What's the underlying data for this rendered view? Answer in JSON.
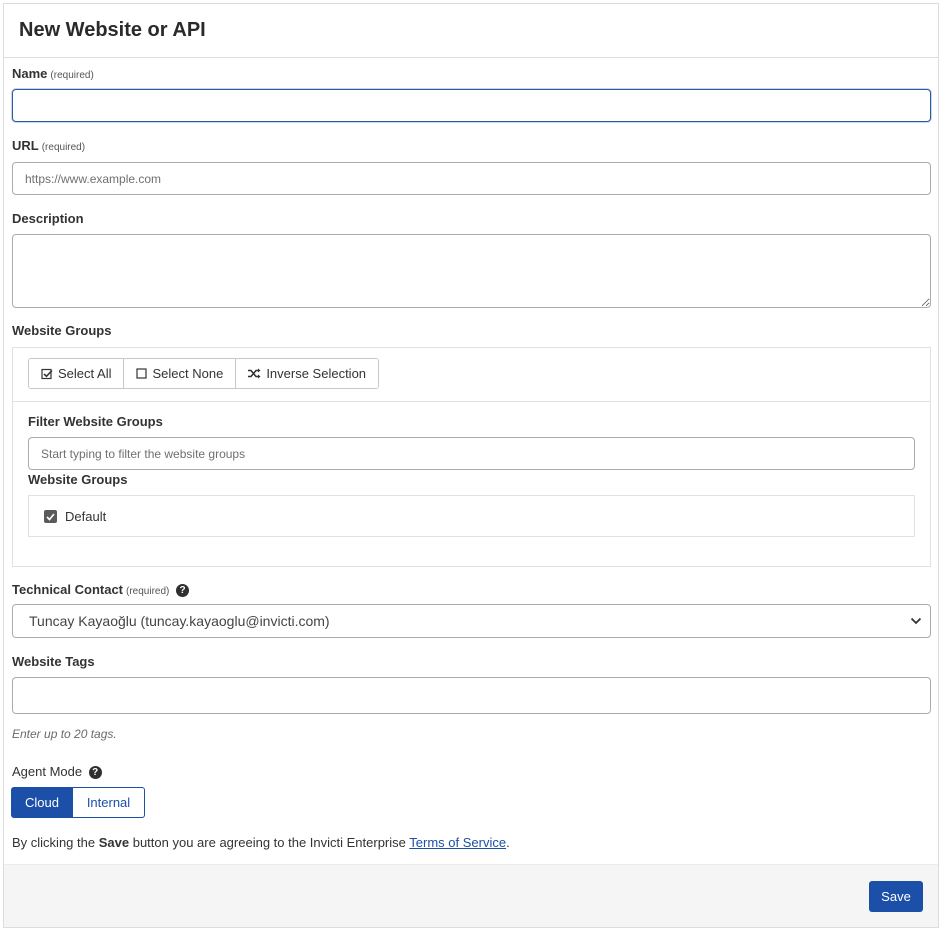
{
  "header": {
    "title": "New Website or API"
  },
  "form": {
    "name": {
      "label": "Name",
      "required": "(required)",
      "value": ""
    },
    "url": {
      "label": "URL",
      "required": "(required)",
      "placeholder": "https://www.example.com",
      "value": ""
    },
    "description": {
      "label": "Description",
      "value": ""
    },
    "website_groups": {
      "label": "Website Groups",
      "select_all": "Select All",
      "select_none": "Select None",
      "inverse_selection": "Inverse Selection",
      "filter_label": "Filter Website Groups",
      "filter_placeholder": "Start typing to filter the website groups",
      "list_label": "Website Groups",
      "items": [
        {
          "label": "Default",
          "checked": true
        }
      ]
    },
    "technical_contact": {
      "label": "Technical Contact",
      "required": "(required)",
      "selected": "Tuncay Kayaoğlu (tuncay.kayaoglu@invicti.com)"
    },
    "website_tags": {
      "label": "Website Tags",
      "value": "",
      "hint": "Enter up to 20 tags."
    },
    "agent_mode": {
      "label": "Agent Mode",
      "options": [
        "Cloud",
        "Internal"
      ],
      "selected": "Cloud"
    },
    "terms": {
      "prefix": "By clicking the",
      "bold": "Save",
      "middle": "button you are agreeing to the Invicti Enterprise",
      "link": "Terms of Service",
      "suffix": "."
    }
  },
  "footer": {
    "save_label": "Save"
  },
  "colors": {
    "primary": "#1b4fa8",
    "border": "#ababab",
    "footer_bg": "#f5f5f5"
  }
}
